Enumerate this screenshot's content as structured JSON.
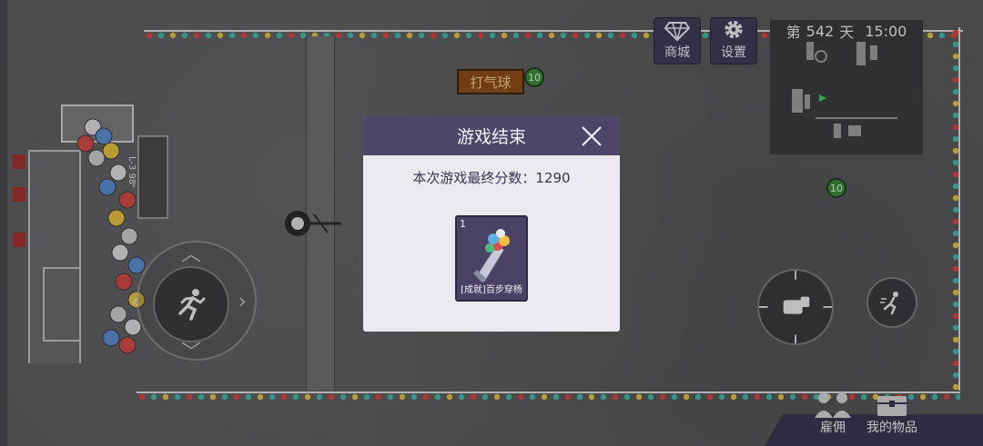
{
  "hud": {
    "shop_label": "商城",
    "settings_label": "设置",
    "day_prefix": "第",
    "day_number": "542",
    "day_suffix": "天",
    "time": "15:00"
  },
  "world": {
    "sign_text": "打气球",
    "balloon_tags": [
      "10",
      "10"
    ],
    "vertical_sign_text": "L-3 98ʶ"
  },
  "bottom_menu": {
    "hire_label": "雇佣",
    "items_label": "我的物品"
  },
  "modal": {
    "title": "游戏结束",
    "score_label": "本次游戏最终分数：",
    "score_value": "1290",
    "reward": {
      "count": "1",
      "name": "[成就]百步穿杨",
      "icon": "balloon-dart-icon"
    }
  },
  "colors": {
    "modal_header": "#4d4668",
    "modal_body": "#ece9f1",
    "item_card": "#4a4264",
    "sign": "#8a4c18"
  }
}
